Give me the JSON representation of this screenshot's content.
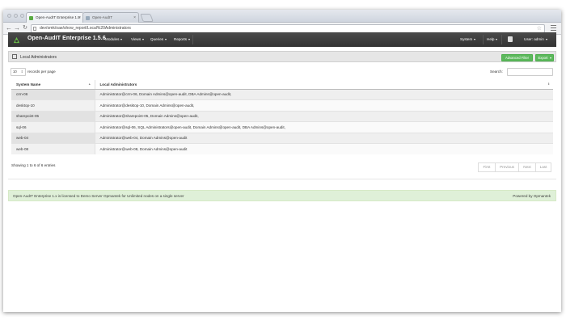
{
  "browser": {
    "tabs": [
      {
        "title": "Open-AudIT Enterprise 1.5"
      },
      {
        "title": "Open-AudIT"
      }
    ],
    "url": "dev/omk/oae/show_report/Local%20Administrators"
  },
  "app": {
    "brand": "Open-AudIT Enterprise 1.5.6",
    "nav": {
      "modules": "Modules",
      "views": "Views",
      "queries": "Queries",
      "reports": "Reports",
      "system": "System",
      "help": "Help",
      "user": "User: admin"
    }
  },
  "panel": {
    "title": "Local Administrators",
    "advanced_filter": "Advanced Filter",
    "export": "Export"
  },
  "table_controls": {
    "page_length": "10",
    "records_label": "records per page",
    "search_label": "Search:",
    "search_value": ""
  },
  "table": {
    "columns": [
      "System Name",
      "Local Administrators"
    ],
    "rows": [
      [
        "crm-06",
        "Administrator@crm-06, Domain Admins@open-audit, DBA Admins@open-audit,"
      ],
      [
        "desktop-10",
        "Administrator@desktop-10, Domain Admins@open-audit,"
      ],
      [
        "sharepoint-05",
        "Administrator@sharepoint-05, Domain Admins@open-audit,"
      ],
      [
        "sql-06",
        "Administrator@sql-06, SQL Administrators@open-audit, Domain Admins@open-audit, DBA Admins@open-audit,"
      ],
      [
        "web-04",
        "Administrator@web-04, Domain Admins@open-audit"
      ],
      [
        "web-08",
        "Administrator@web-08, Domain Admins@open-audit"
      ]
    ]
  },
  "info_text": "Showing 1 to 6 of 6 entries",
  "pagination": {
    "first": "First",
    "previous": "Previous",
    "next": "Next",
    "last": "Last"
  },
  "footer": {
    "license": "Open-AudIT Enterprise 1.x is licensed to Demo Server Opmantek for Unlimited nodes on a single server",
    "powered": "Powered by Opmantek"
  },
  "colors": {
    "navbar": "#3b3b3b",
    "button_green": "#5cb85c",
    "footer_bg": "#dff0d8",
    "logo_green": "#6cc04a"
  }
}
